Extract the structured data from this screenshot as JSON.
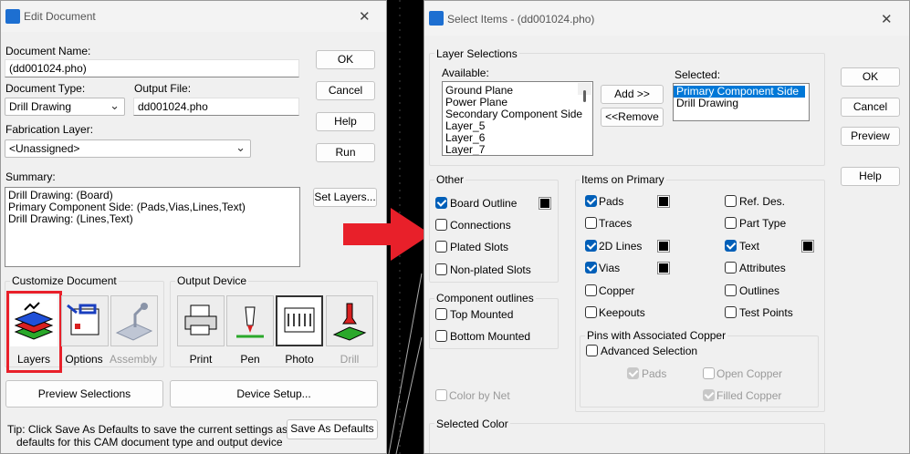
{
  "edit_dialog": {
    "title": "Edit Document",
    "document_name_label": "Document Name:",
    "document_name_value": "(dd001024.pho)",
    "document_type_label": "Document Type:",
    "document_type_value": "Drill Drawing",
    "output_file_label": "Output File:",
    "output_file_value": "dd001024.pho",
    "fabrication_layer_label": "Fabrication Layer:",
    "fabrication_layer_value": "<Unassigned>",
    "summary_label": "Summary:",
    "summary_lines": [
      "Drill Drawing: (Board)",
      "Primary Component Side: (Pads,Vias,Lines,Text)",
      "Drill Drawing: (Lines,Text)"
    ],
    "buttons": {
      "ok": "OK",
      "cancel": "Cancel",
      "help": "Help",
      "run": "Run",
      "set_layers": "Set Layers...",
      "preview_selections": "Preview Selections",
      "device_setup": "Device Setup...",
      "save_as_defaults": "Save As Defaults"
    },
    "customize_document_title": "Customize Document",
    "customize_items": [
      "Layers",
      "Options",
      "Assembly"
    ],
    "output_device_title": "Output Device",
    "output_devices": [
      "Print",
      "Pen",
      "Photo",
      "Drill"
    ],
    "tip_line1": "Tip: Click Save As Defaults to save the current settings as the",
    "tip_line2": "defaults for this CAM document type and output device"
  },
  "select_dialog": {
    "title": "Select Items - (dd001024.pho)",
    "layer_selections_title": "Layer Selections",
    "available_label": "Available:",
    "available_items": [
      "Ground Plane",
      "Power Plane",
      "Secondary Component Side",
      "Layer_5",
      "Layer_6",
      "Layer_7"
    ],
    "selected_label": "Selected:",
    "selected_items": [
      "Primary Component Side",
      "Drill Drawing"
    ],
    "add_button": "Add >>",
    "remove_button": "<<Remove",
    "buttons": {
      "ok": "OK",
      "cancel": "Cancel",
      "preview": "Preview",
      "help": "Help"
    },
    "other_title": "Other",
    "other_items": [
      {
        "label": "Board Outline",
        "checked": true
      },
      {
        "label": "Connections",
        "checked": false
      },
      {
        "label": "Plated Slots",
        "checked": false
      },
      {
        "label": "Non-plated Slots",
        "checked": false
      }
    ],
    "component_outlines_title": "Component outlines",
    "component_outline_items": [
      {
        "label": "Top Mounted",
        "checked": false
      },
      {
        "label": "Bottom Mounted",
        "checked": false
      }
    ],
    "color_by_net": "Color by Net",
    "items_on_primary_title": "Items on Primary",
    "primary_left": [
      {
        "label": "Pads",
        "checked": true
      },
      {
        "label": "Traces",
        "checked": false
      },
      {
        "label": "2D Lines",
        "checked": true
      },
      {
        "label": "Vias",
        "checked": true
      },
      {
        "label": "Copper",
        "checked": false
      },
      {
        "label": "Keepouts",
        "checked": false
      }
    ],
    "primary_right": [
      {
        "label": "Ref. Des.",
        "checked": false
      },
      {
        "label": "Part Type",
        "checked": false
      },
      {
        "label": "Text",
        "checked": true
      },
      {
        "label": "Attributes",
        "checked": false
      },
      {
        "label": "Outlines",
        "checked": false
      },
      {
        "label": "Test Points",
        "checked": false
      }
    ],
    "pins_title": "Pins with Associated Copper",
    "advanced_selection": "Advanced Selection",
    "pins_pads": "Pads",
    "open_copper": "Open Copper",
    "filled_copper": "Filled Copper",
    "selected_color_title": "Selected Color"
  },
  "colors": {
    "arrow": "#e8202a",
    "highlight_border": "#e8202a",
    "selection": "#0078d7",
    "check": "#005fb8"
  }
}
